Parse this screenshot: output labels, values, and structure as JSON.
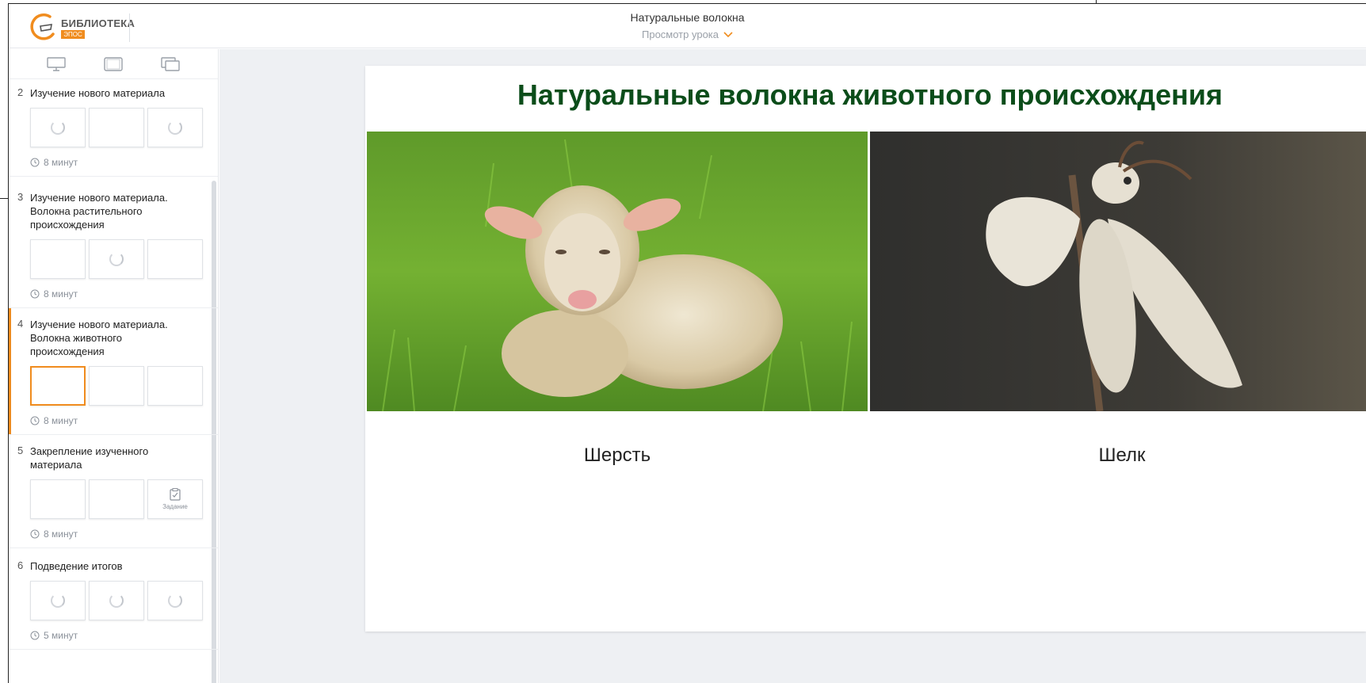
{
  "header": {
    "logo_title": "БИБЛИОТЕКА",
    "logo_badge": "ЭПОС",
    "lesson_title": "Натуральные волокна",
    "view_mode": "Просмотр урока"
  },
  "sidebar": {
    "view_icons": [
      "monitor-icon",
      "tablet-icon",
      "multi-window-icon"
    ],
    "stages": [
      {
        "num": "2",
        "title": "Изучение нового материала",
        "duration": "8 минут"
      },
      {
        "num": "3",
        "title": "Изучение нового материала. Волокна растительного происхождения",
        "duration": "8 минут"
      },
      {
        "num": "4",
        "title": "Изучение нового материала. Волокна животного происхождения",
        "duration": "8 минут"
      },
      {
        "num": "5",
        "title": "Закрепление изученного материала",
        "duration": "8 минут",
        "task_label": "Задание"
      },
      {
        "num": "6",
        "title": "Подведение итогов",
        "duration": "5 минут"
      }
    ]
  },
  "slide": {
    "title": "Натуральные волокна животного происхождения",
    "left_caption": "Шерсть",
    "right_caption": "Шелк"
  },
  "colors": {
    "accent": "#f08c1e",
    "title_green": "#0b4d1a",
    "background": "#eef0f3"
  }
}
